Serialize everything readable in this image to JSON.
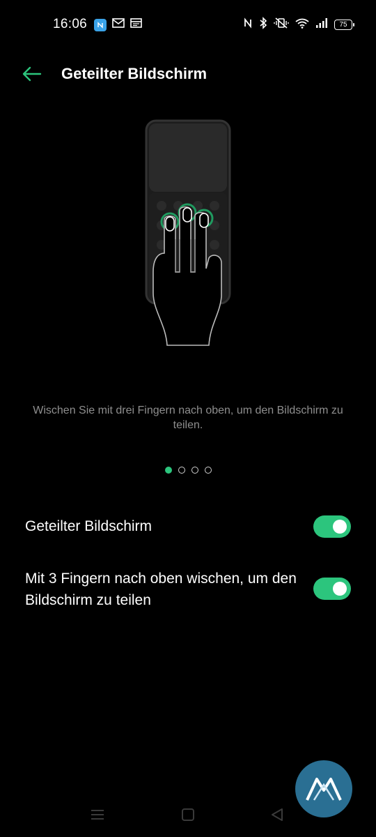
{
  "status_bar": {
    "time": "16:06",
    "battery_level": "75",
    "left_icons": [
      "nfc-app-icon",
      "mail-icon",
      "calendar-icon"
    ],
    "right_icons": [
      "nfc-icon",
      "bluetooth-icon",
      "vibrate-off-icon",
      "wifi-icon",
      "cellular-signal-icon",
      "battery-icon"
    ]
  },
  "header": {
    "title": "Geteilter Bildschirm",
    "back_icon": "back-arrow-icon"
  },
  "illustration": {
    "icon": "three-finger-swipe-illustration"
  },
  "description": "Wischen Sie mit drei Fingern nach oben, um den Bildschirm zu teilen.",
  "pager": {
    "total": 4,
    "active_index": 0
  },
  "settings": [
    {
      "label": "Geteilter Bildschirm",
      "enabled": true
    },
    {
      "label": "Mit 3 Fingern nach oben wischen, um den Bildschirm zu teilen",
      "enabled": true
    }
  ],
  "nav_bar": {
    "icons": [
      "recents-icon",
      "home-icon",
      "back-icon"
    ]
  },
  "colors": {
    "accent": "#2cc57d",
    "background": "#000000",
    "secondary_text": "#8e8e8e"
  }
}
